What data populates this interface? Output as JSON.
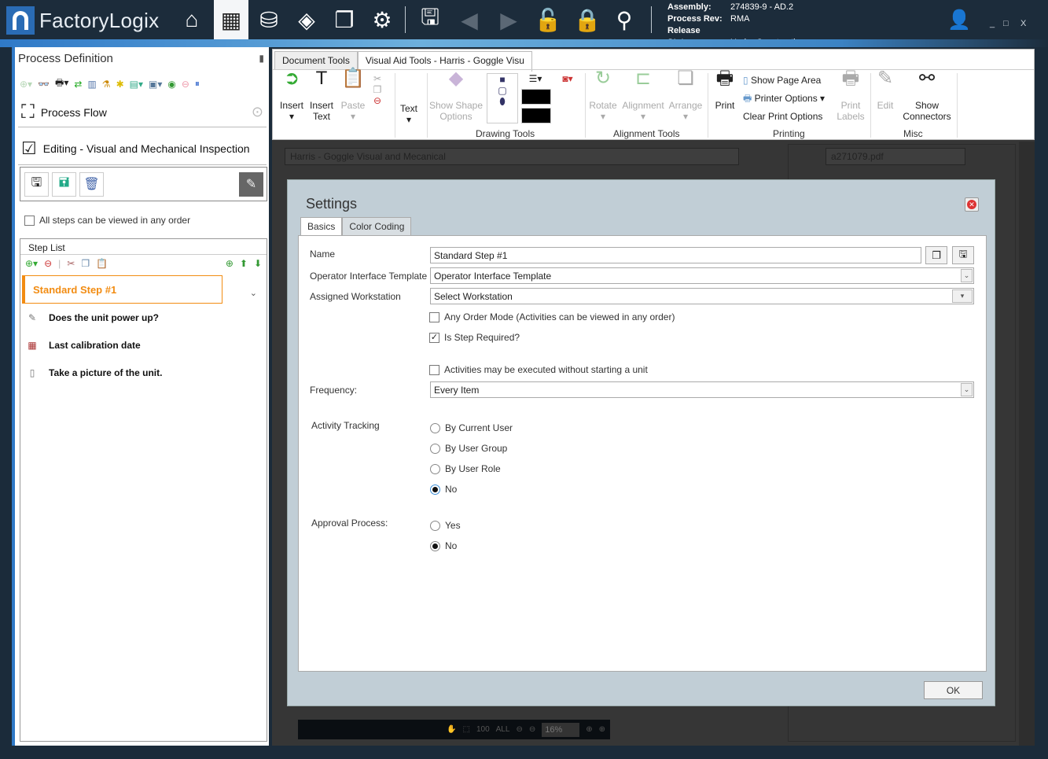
{
  "app": {
    "brand": "FactoryLogix",
    "logo_letter": "n"
  },
  "topbar": {
    "icons": [
      "home-icon",
      "grid-edit-icon",
      "database-import-icon",
      "navigate-icon",
      "windows-icon",
      "gear-icon",
      "save-icon",
      "back-icon",
      "forward-icon",
      "unlock-icon",
      "lock-x-icon",
      "hierarchy-search-icon"
    ],
    "assembly_label": "Assembly:",
    "assembly_value": "274839-9 - AD.2",
    "rev_label": "Process Rev:",
    "rev_value": "RMA",
    "status_label": "Release Status:",
    "status_value": "Under Construction",
    "user_icon": "user-remove-icon",
    "minimize": "_",
    "maximize": "□",
    "close": "X"
  },
  "left_panel": {
    "title": "Process Definition",
    "pin": "📌",
    "process_flow": "Process Flow",
    "editing": "Editing - Visual and Mechanical Inspection",
    "any_order_label": "All steps can be viewed in any order",
    "any_order_checked": false,
    "step_list": {
      "header": "Step List",
      "selected_step": "Standard Step #1",
      "items": [
        {
          "icon": "note-icon",
          "label": "Does the unit power up?"
        },
        {
          "icon": "calendar-icon",
          "label": "Last calibration date"
        },
        {
          "icon": "device-icon",
          "label": "Take a picture of the unit."
        }
      ]
    }
  },
  "ribbon": {
    "tabs": [
      {
        "label": "Document Tools",
        "active": false
      },
      {
        "label": "Visual Aid Tools - Harris - Goggle Visu",
        "active": true
      }
    ],
    "buttons": {
      "insert": "Insert",
      "insert_text_1": "Insert",
      "insert_text_2": "Text",
      "paste": "Paste",
      "text": "Text",
      "show_shape_1": "Show Shape",
      "show_shape_2": "Options",
      "rotate": "Rotate",
      "alignment": "Alignment",
      "arrange": "Arrange",
      "print": "Print",
      "show_page_area": "Show Page Area",
      "printer_options": "Printer Options",
      "clear_print_options": "Clear Print Options",
      "print_labels_1": "Print",
      "print_labels_2": "Labels",
      "edit": "Edit",
      "show_connectors_1": "Show",
      "show_connectors_2": "Connectors"
    },
    "groups": {
      "drawing": "Drawing Tools",
      "alignment": "Alignment Tools",
      "printing": "Printing",
      "misc": "Misc"
    }
  },
  "workspace": {
    "document_title": "Harris - Goggle Visual and Mecanical",
    "pdf_name": "a271079.pdf",
    "zoom_level": "16%",
    "zoom_labels": [
      "100",
      "ALL"
    ]
  },
  "dialog": {
    "title": "Settings",
    "tabs": [
      {
        "label": "Basics",
        "active": true
      },
      {
        "label": "Color Coding",
        "active": false
      }
    ],
    "fields": {
      "name_label": "Name",
      "name_value": "Standard Step #1",
      "oit_label": "Operator Interface Template",
      "oit_value": "Operator Interface Template",
      "workstation_label": "Assigned Workstation",
      "workstation_value": "Select Workstation",
      "any_order_label": "Any Order Mode (Activities can be viewed in any order)",
      "any_order_checked": false,
      "required_label": "Is Step Required?",
      "required_checked": true,
      "no_unit_label": "Activities may be executed without starting a unit",
      "no_unit_checked": false,
      "frequency_label": "Frequency:",
      "frequency_value": "Every Item"
    },
    "activity_tracking": {
      "label": "Activity Tracking",
      "options": [
        "By Current User",
        "By User Group",
        "By User Role",
        "No"
      ],
      "selected": "No"
    },
    "approval_process": {
      "label": "Approval Process:",
      "options": [
        "Yes",
        "No"
      ],
      "selected": "No"
    },
    "ok_label": "OK"
  }
}
